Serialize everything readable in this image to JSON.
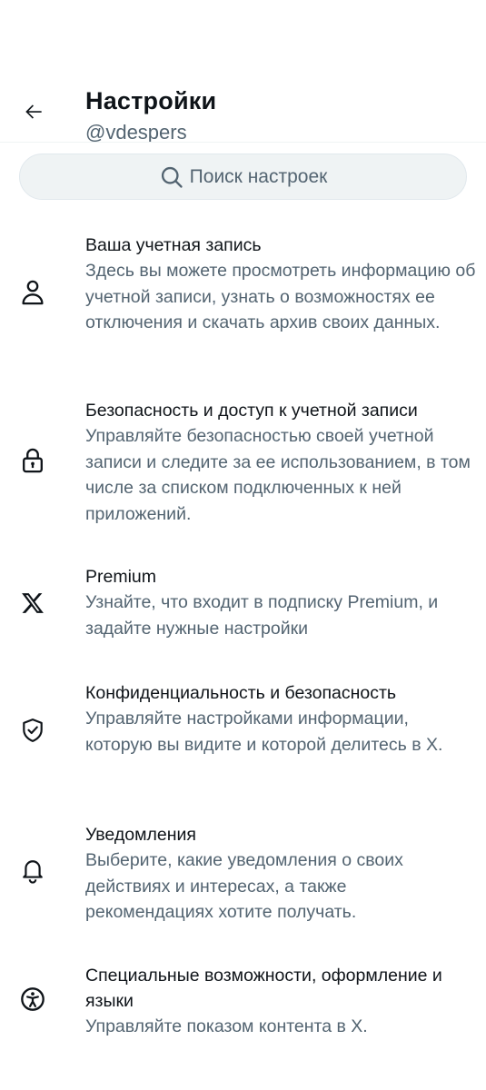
{
  "header": {
    "title": "Настройки",
    "handle": "@vdespers",
    "back_icon": "arrow-left-icon"
  },
  "search": {
    "placeholder": "Поиск настроек",
    "icon": "search-icon"
  },
  "items": [
    {
      "title": "Ваша учетная запись",
      "description": "Здесь вы можете просмотреть информацию об учетной записи, узнать о возможностях ее отключения и скачать архив своих данных.",
      "icon": "person-icon"
    },
    {
      "title": "Безопасность и доступ к учетной записи",
      "description": "Управляйте безопасностью своей учетной записи и следите за ее использованием, в том числе за списком подключенных к ней приложений.",
      "icon": "lock-icon"
    },
    {
      "title": "Premium",
      "description": "Узнайте, что входит в подписку Premium, и задайте нужные настройки",
      "icon": "x-logo-icon"
    },
    {
      "title": "Конфиденциальность и безопасность",
      "description": "Управляйте настройками информации, которую вы видите и которой делитесь в X.",
      "icon": "shield-check-icon"
    },
    {
      "title": "Уведомления",
      "description": "Выберите, какие уведомления о своих действиях и интересах, а также рекомендациях хотите получать.",
      "icon": "bell-icon"
    },
    {
      "title": "Специальные возможности, оформление и языки",
      "description": "Управляйте показом контента в X.",
      "icon": "accessibility-icon"
    }
  ],
  "colors": {
    "primary_text": "#0f1419",
    "secondary_text": "#536471",
    "search_bg": "#eff3f4"
  }
}
